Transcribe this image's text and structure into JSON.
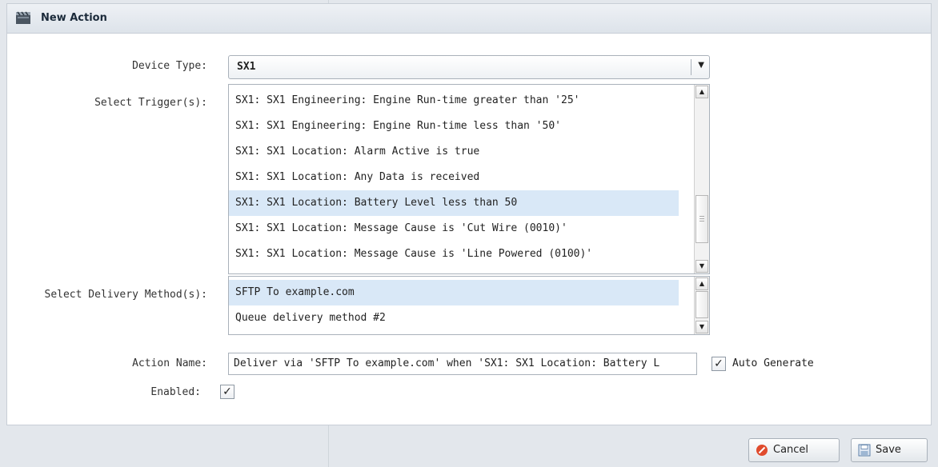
{
  "dialog": {
    "title": "New Action",
    "icon": "clapperboard-icon"
  },
  "device_type": {
    "label": "Device Type:",
    "value": "SX1"
  },
  "triggers": {
    "label": "Select Trigger(s):",
    "items": [
      "SX1: SX1 Engineering: Engine Run-time greater than '25'",
      "SX1: SX1 Engineering: Engine Run-time less than '50'",
      "SX1: SX1 Location: Alarm Active is true",
      "SX1: SX1 Location: Any Data is received",
      "SX1: SX1 Location: Battery Level less than 50",
      "SX1: SX1 Location: Message Cause is 'Cut Wire (0010)'",
      "SX1: SX1 Location: Message Cause is 'Line Powered (0100)'"
    ],
    "selected_index": 4
  },
  "delivery": {
    "label": "Select Delivery Method(s):",
    "items": [
      "SFTP To example.com",
      "Queue delivery method #2"
    ],
    "selected_index": 0
  },
  "action_name": {
    "label": "Action Name:",
    "value": "Deliver via 'SFTP To example.com' when 'SX1: SX1 Location: Battery L",
    "auto_generate_label": "Auto Generate",
    "auto_generate_checked": true
  },
  "enabled": {
    "label": "Enabled:",
    "checked": true
  },
  "buttons": {
    "cancel": "Cancel",
    "save": "Save"
  },
  "background_text": "...",
  "colors": {
    "selection": "#d9e8f7",
    "cancel_icon": "#e04b2d"
  }
}
